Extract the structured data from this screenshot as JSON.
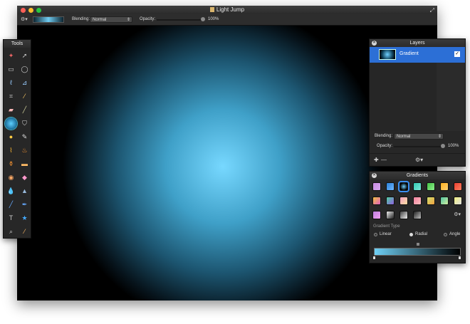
{
  "window": {
    "title": "Light Jump",
    "traffic_lights": [
      "#ff5f57",
      "#ffbd2e",
      "#28c840"
    ]
  },
  "toolbar": {
    "gear_icon": "gear-icon",
    "blending_label": "Blending:",
    "blending_value": "Normal",
    "opacity_label": "Opacity:",
    "opacity_value": "100%",
    "opacity_level": 1.0,
    "gradient_preview_colors": [
      "#0c2430",
      "#6fcbf0"
    ]
  },
  "canvas": {
    "gradient_type": "radial",
    "center_color": "#77d8ff",
    "edge_color": "#000000"
  },
  "tools_panel": {
    "title": "Tools",
    "tools": [
      {
        "name": "magic-wand-icon",
        "glyph": "✦"
      },
      {
        "name": "move-icon",
        "glyph": "➚"
      },
      {
        "name": "rect-select-icon",
        "glyph": "▭"
      },
      {
        "name": "ellipse-select-icon",
        "glyph": "◯"
      },
      {
        "name": "lasso-icon",
        "glyph": "ℓ"
      },
      {
        "name": "polygon-lasso-icon",
        "glyph": "⊿"
      },
      {
        "name": "crop-icon",
        "glyph": "⌗"
      },
      {
        "name": "eyedropper-icon",
        "glyph": "⁄"
      },
      {
        "name": "eraser-icon",
        "glyph": "▰"
      },
      {
        "name": "pencil-icon",
        "glyph": "╱"
      },
      {
        "name": "gradient-icon",
        "glyph": ""
      },
      {
        "name": "paint-bucket-icon",
        "glyph": "⛉"
      },
      {
        "name": "smudge-icon",
        "glyph": "●"
      },
      {
        "name": "sharpen-icon",
        "glyph": "✎"
      },
      {
        "name": "brush-icon",
        "glyph": "⌇"
      },
      {
        "name": "burn-icon",
        "glyph": "♨"
      },
      {
        "name": "stamp-icon",
        "glyph": "⚱"
      },
      {
        "name": "heal-icon",
        "glyph": "▬"
      },
      {
        "name": "red-eye-icon",
        "glyph": "◉"
      },
      {
        "name": "dodge-icon",
        "glyph": "◆"
      },
      {
        "name": "drop-icon",
        "glyph": "💧"
      },
      {
        "name": "cone-icon",
        "glyph": "▲"
      },
      {
        "name": "line-icon",
        "glyph": "╱"
      },
      {
        "name": "pen-icon",
        "glyph": "✒"
      },
      {
        "name": "text-icon",
        "glyph": "T"
      },
      {
        "name": "shape-icon",
        "glyph": "★"
      },
      {
        "name": "zoom-icon",
        "glyph": "⌕"
      },
      {
        "name": "color-picker-icon",
        "glyph": "⁄"
      }
    ],
    "active_tool_index": 10,
    "glyph_colors": [
      "#e66",
      "#ccc",
      "#ccc",
      "#ccc",
      "#9cf",
      "#9cf",
      "#ccc",
      "#fc6",
      "#fbb",
      "#cc9",
      "",
      "#ddd",
      "#fc4",
      "#ddd",
      "#fb3",
      "#f93",
      "#f93",
      "#fb6",
      "#fa6",
      "#f9c",
      "#6af",
      "#9bd",
      "#6af",
      "#6af",
      "#ccc",
      "#4af",
      "#ccc",
      "#fb6"
    ]
  },
  "layers_panel": {
    "title": "Layers",
    "layers": [
      {
        "name": "Gradient",
        "visible": true
      }
    ],
    "blending_label": "Blending:",
    "blending_value": "Normal",
    "opacity_label": "Opacity:",
    "opacity_value": "100%",
    "opacity_level": 1.0,
    "add_icon": "plus-icon",
    "remove_icon": "minus-icon",
    "gear_icon": "gear-icon"
  },
  "gradients_panel": {
    "title": "Gradients",
    "swatches": [
      [
        "#c98be0",
        "#d6a8f0"
      ],
      [
        "#2b7fd6",
        "#6fb7ff"
      ],
      [
        "#6fd0ff",
        "#000000"
      ],
      [
        "#30c9b0",
        "#7fe8d8"
      ],
      [
        "#44c044",
        "#8ef08e"
      ],
      [
        "#ffb020",
        "#ffd070"
      ],
      [
        "#e84030",
        "#ff8060"
      ],
      [
        "#f0c040",
        "#e060c0"
      ],
      [
        "#50d0a0",
        "#9060e0"
      ],
      [
        "#f0a0c0",
        "#ffe0a0"
      ],
      [
        "#f080a0",
        "#ffc0c0"
      ],
      [
        "#d0e070",
        "#f0a040"
      ],
      [
        "#50c0a0",
        "#d0f0a0"
      ],
      [
        "#f0f080",
        "#e0e0e0"
      ],
      [
        "#c080e0",
        "#f0a0f0"
      ],
      [
        "#f0f0f0",
        "#202020"
      ],
      [
        "#404040",
        "#f0f0f0"
      ],
      [
        "#202020",
        "#c0c0c0"
      ]
    ],
    "selected_swatch_index": 2,
    "gear_icon": "gear-icon",
    "gradient_type_label": "Gradient Type",
    "types": [
      "Linear",
      "Radial",
      "Angle"
    ],
    "selected_type": "Radial",
    "bar_colors": [
      "#6fd0f5",
      "#000000"
    ]
  }
}
